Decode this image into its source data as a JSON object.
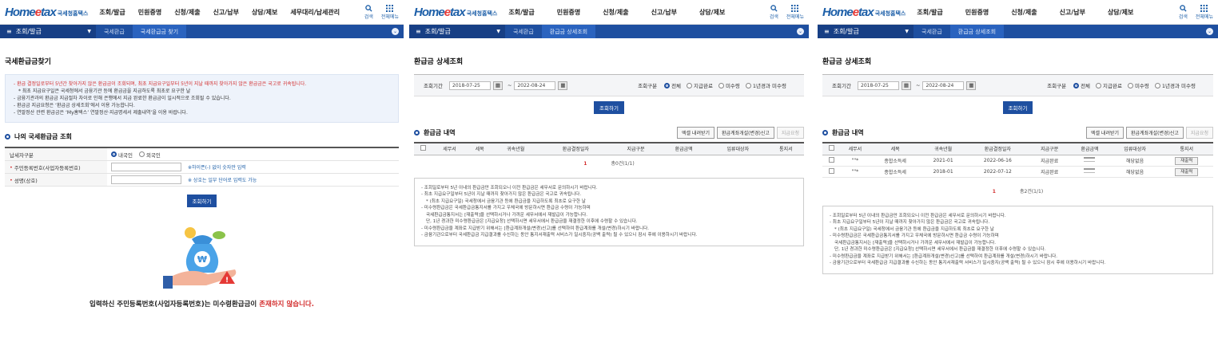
{
  "header": {
    "brand_main": "Home",
    "brand_e": "e",
    "brand_tax": "tax",
    "brand_sub": "국세청홈택스",
    "search_label": "검색",
    "allmenu_label": "전체메뉴"
  },
  "nav_p1": [
    "조회/발급",
    "민원증명",
    "신청/제출",
    "신고/납부",
    "상담/제보",
    "세무대리/납세관리"
  ],
  "nav_p2": [
    "조회/발급",
    "민원증명",
    "신청/제출",
    "신고/납부",
    "상담/제보"
  ],
  "nav_p3": [
    "조회/발급",
    "민원증명",
    "신청/제출",
    "신고/납부",
    "상담/제보"
  ],
  "bar": {
    "menu_label": "조회/발급",
    "p1_crumbs": [
      "국세환급",
      "국세환급금 찾기"
    ],
    "p2_crumbs": [
      "국세환급",
      "환급금 상세조회"
    ]
  },
  "p1": {
    "title": "국세환급금찾기",
    "notes": [
      "- 환급 결정일로부터 5년간 찾아가지 않은 환급금이 조회되며, 최초 지급요구일부터 5년이 지날 때까지 찾아가지 않은 환급금은 국고로 귀속됩니다.",
      "* 최초 지급요구일은 국세청에서 금융기관 등에 환급금을 지급하도록 최초로 요구한 날",
      "- 금융기관과의 환급금 지급절차 차이로 인해 은행에서 지급 완료한 환급금이 일시적으로 조회될 수 있습니다.",
      "- 환급금 지급요청은 ‘환급금 상세조회’에서 이용 가능합니다.",
      "- 연말정산 관련 환급금은 ‘My홈택스’ 연말정산·지급명세서 제출내역’을 이용 바랍니다."
    ],
    "section_title": "나의 국세환급금 조회",
    "form": {
      "type_label": "납세자구분",
      "opt_domestic": "내국인",
      "opt_foreign": "외국인",
      "id_label": "주민등록번호(사업자등록번호)",
      "id_hint": "※하이픈(-) 없이 숫자만 입력",
      "name_label": "성명(상호)",
      "name_hint": "※ 상호는 일부 단어로 입력도 가능",
      "search_btn": "조회하기"
    },
    "msg_pre": "입력하신 주민등록번호(사업자등록번호)는 미수령환급금이 ",
    "msg_red": "존재하지 않습니다."
  },
  "detail": {
    "title": "환급금 상세조회",
    "period_label": "조회기간",
    "date_from": "2018-07-25",
    "date_to": "2022-08-24",
    "tilde": "~",
    "gubun_label": "조회구분",
    "opt_all": "전체",
    "opt_paid": "지급완료",
    "opt_unpaid": "미수령",
    "opt_1yr": "1년경과 미수령",
    "search_btn": "조회하기",
    "list_title": "환급금 내역",
    "btn_excel": "엑셀 내려받기",
    "btn_account": "환급계좌개설(변경)신고",
    "btn_pay": "지급요청",
    "columns": [
      "",
      "세무서",
      "세목",
      "귀속년월",
      "환급결정일자",
      "지급구분",
      "환급금액",
      "입류대상자",
      "통지서"
    ],
    "pager_num": "1",
    "pager_total": "총0건(1/1)",
    "pager_total3": "총2건(1/1)",
    "info": [
      "- 조회일로부터 5년 이내의 환급금만 조회되오니 이전 환급금은 세무서로 문의하시기 바랍니다.",
      "- 최초 지급요구일부터 5년이 지날 때까지 찾아가지 않은 환급금은 국고로 귀속됩니다.",
      "  * (최초 지급요구일) 국세청에서 금융기관 등에 환급금을 지급하도록 최초로 요구한 날",
      "- 미수령환급금은 국세환급금통지서를 가지고 우체국에 방문하시면 환급금 수령이 가능하며",
      "  국세환급금통지서는 [재출력]을 선택하시거나 가까운 세무서에서 재발급이 가능합니다.",
      "  단, 1년 경과한 미수령환급금은 [지급요청] 선택하시면 세무서에서 환급금을 재결정한 이후에 수령할 수 있습니다.",
      "- 미수령환급금을 계좌로 지급받기 위해서는 [환급계좌개설(변경)신고]를 선택하여 환급계좌를 개설(변경)하시기 바랍니다.",
      "- 금융기관으로부터 국세환급금 지급결과를 수신하는 동안 통지서재출력 서비스가 일시중지(공백 출력) 될 수 있으니 잠시 후에 이용하시기 바랍니다."
    ],
    "rows": [
      {
        "office": "\"\"*",
        "item": "종합소득세",
        "period": "2021-01",
        "date": "2022-06-16",
        "pay": "지급완료",
        "target": "해당없음",
        "notice": "재출력"
      },
      {
        "office": "\"\"*",
        "item": "종합소득세",
        "period": "2018-01",
        "date": "2022-07-12",
        "pay": "지급완료",
        "target": "해당없음",
        "notice": "재출력"
      }
    ]
  }
}
